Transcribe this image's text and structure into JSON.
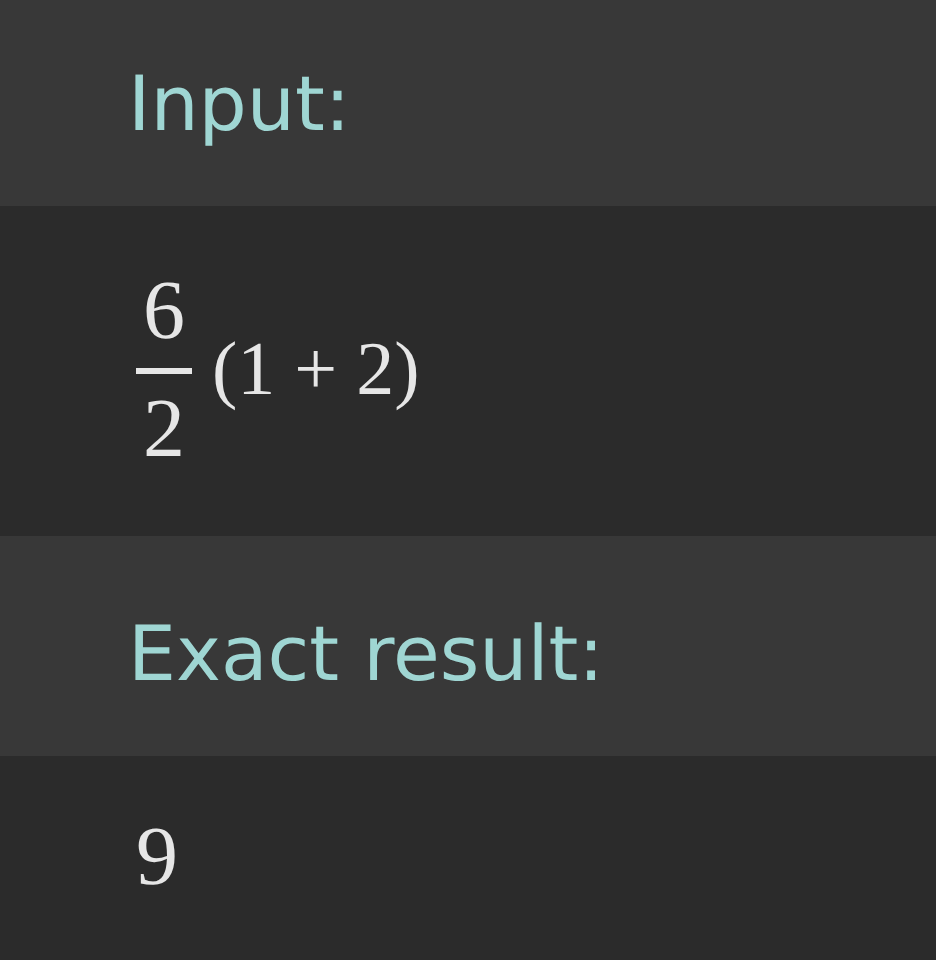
{
  "sections": [
    {
      "label": "Input:",
      "kind": "fraction",
      "numerator": "6",
      "denominator": "2",
      "rest": "(1 + 2)"
    },
    {
      "label": "Exact result:",
      "kind": "plain",
      "value": "9"
    }
  ]
}
